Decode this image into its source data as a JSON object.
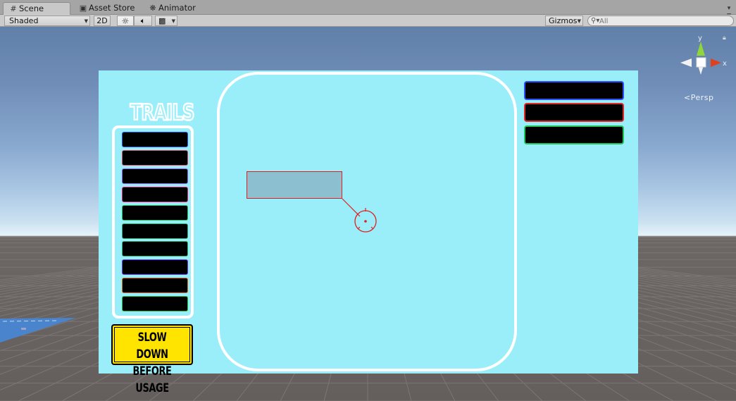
{
  "tabs": [
    {
      "label": "Scene",
      "icon": "grid-icon",
      "active": true
    },
    {
      "label": "Asset Store",
      "icon": "store-icon",
      "active": false
    },
    {
      "label": "Animator",
      "icon": "animator-icon",
      "active": false
    }
  ],
  "toolbar": {
    "draw_mode": "Shaded",
    "mode_2d": "2D",
    "lighting_icon": "sun-icon",
    "audio_icon": "speaker-icon",
    "effects_icon": "image-icon",
    "gizmos_label": "Gizmos",
    "search_placeholder": "All"
  },
  "scene": {
    "title_text": "TRAILS",
    "warning_line1": "SLOW DOWN",
    "warning_line2": "BEFORE USAGE",
    "trail_slot_colors": [
      "#2a52ff",
      "#e04a6a",
      "#8a5cff",
      "#e0287a",
      "#22c25a",
      "#2fa870",
      "#2bb56a",
      "#6a3cff",
      "#e07028",
      "#26c040"
    ],
    "right_slot_colors": [
      "#2a52ff",
      "#e02a2a",
      "#22c55a"
    ],
    "board_color": "#9aeefa",
    "selection_color": "#e02020"
  },
  "orientation_gizmo": {
    "y_label": "y",
    "x_label": "x",
    "projection_label": "Persp"
  }
}
